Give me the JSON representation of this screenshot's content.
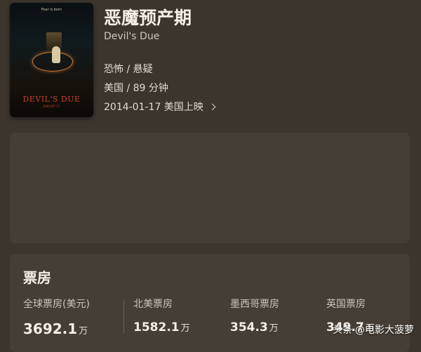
{
  "movie": {
    "title": "恶魔预产期",
    "original_title": "Devil's Due",
    "genres": "恐怖 / 悬疑",
    "country_duration": "美国 / 89 分钟",
    "release": "2014-01-17 美国上映"
  },
  "poster": {
    "tagline": "Fear is born",
    "title": "DEVIL'S DUE",
    "date": "JANUARY 17"
  },
  "box_office": {
    "title": "票房",
    "stats": [
      {
        "label": "全球票房(美元)",
        "value": "3692.1",
        "unit": "万"
      },
      {
        "label": "北美票房",
        "value": "1582.1",
        "unit": "万"
      },
      {
        "label": "墨西哥票房",
        "value": "354.3",
        "unit": "万"
      },
      {
        "label": "英国票房",
        "value": "349.7",
        "unit": "万"
      }
    ]
  },
  "watermark": {
    "brand": "头条",
    "handle": "@电影大菠萝"
  }
}
